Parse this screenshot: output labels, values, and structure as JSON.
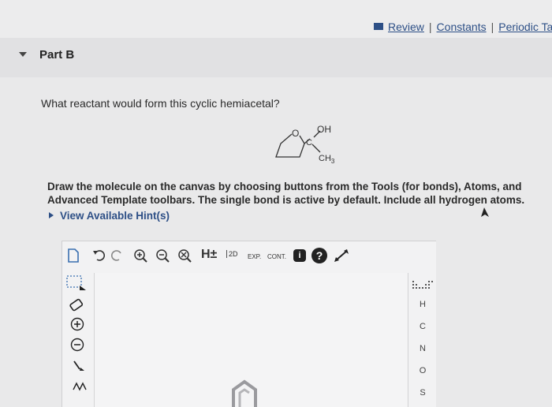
{
  "header": {
    "links": [
      "Review",
      "Constants",
      "Periodic Tabl"
    ],
    "separator": "|"
  },
  "part": {
    "title": "Part B"
  },
  "question": {
    "text": "What reactant would form this cyclic hemiacetal?"
  },
  "molecule": {
    "labels": {
      "o": "O",
      "oh": "OH",
      "c": "C",
      "ch3": "CH",
      "ch3_sub": "3"
    }
  },
  "instructions": {
    "text": "Draw the molecule on the canvas by choosing buttons from the Tools (for bonds), Atoms, and Advanced Template toolbars. The single bond is active by default. Include all hydrogen atoms."
  },
  "hint": {
    "label": "View Available Hint(s)"
  },
  "toolbar": {
    "h_label": "H±",
    "d2_label": "2D",
    "exp_label": "EXP.",
    "cont_label": "CONT.",
    "info_label": "i",
    "help_label": "?"
  },
  "atoms": {
    "items": [
      "H",
      "C",
      "N",
      "O",
      "S"
    ]
  },
  "colors": {
    "link": "#2d4f86",
    "background": "#e9e9ea"
  }
}
